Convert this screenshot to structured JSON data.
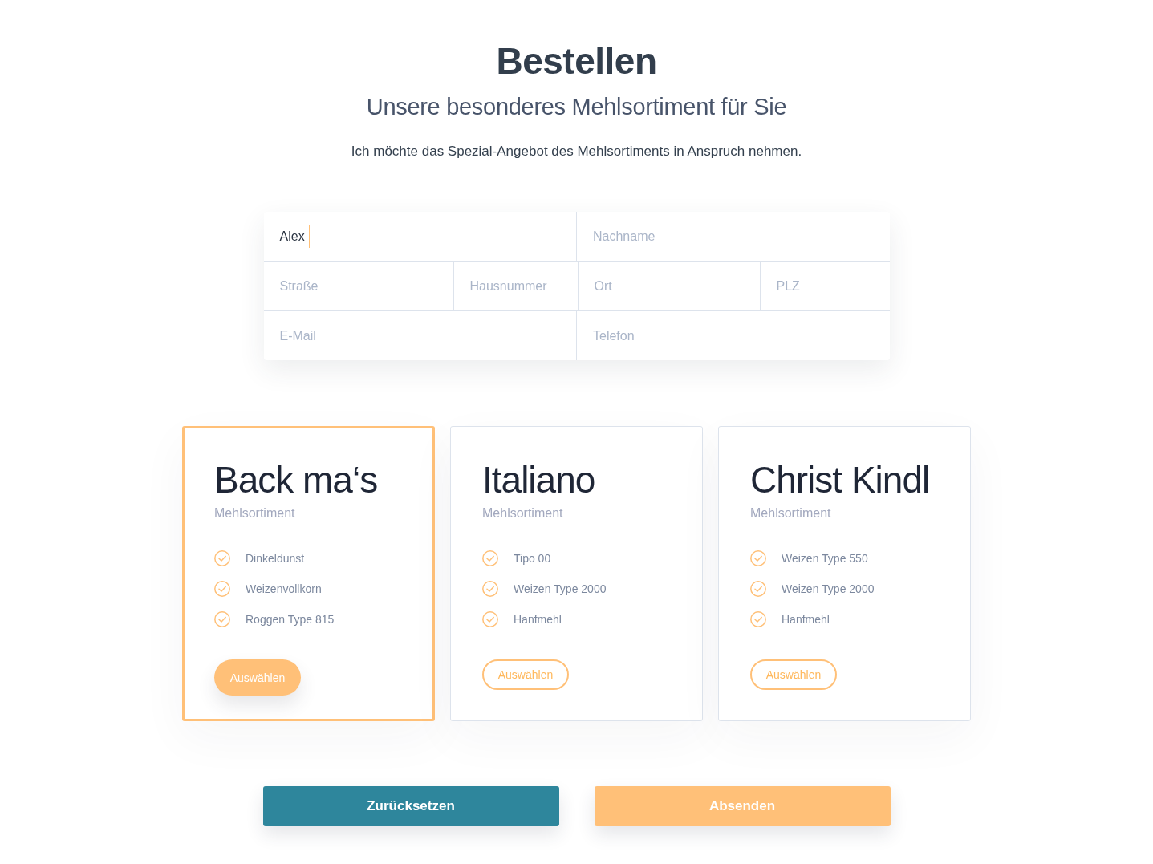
{
  "header": {
    "title": "Bestellen",
    "subtitle": "Unsere besonderes Mehlsortiment für Sie",
    "intro": "Ich möchte das Spezial-Angebot des Mehlsortiments in Anspruch nehmen."
  },
  "form": {
    "rows": [
      [
        {
          "value": "Alex",
          "focused": true
        },
        {
          "placeholder": "Nachname",
          "focused": false
        }
      ],
      [
        {
          "placeholder": "Straße",
          "focused": false
        },
        {
          "placeholder": "Hausnummer",
          "focused": false
        },
        {
          "placeholder": "Ort",
          "focused": false
        },
        {
          "placeholder": "PLZ",
          "focused": false
        }
      ],
      [
        {
          "placeholder": "E-Mail",
          "focused": false
        },
        {
          "placeholder": "Telefon",
          "focused": false
        }
      ]
    ]
  },
  "offers": [
    {
      "name": "Back ma‘s",
      "subtitle": "Mehlsortiment",
      "items": [
        "Dinkeldunst",
        "Weizenvollkorn",
        "Roggen Type 815"
      ],
      "button": "Auswählen",
      "selected": true
    },
    {
      "name": "Italiano",
      "subtitle": "Mehlsortiment",
      "items": [
        "Tipo 00",
        "Weizen Type 2000",
        "Hanfmehl"
      ],
      "button": "Auswählen",
      "selected": false
    },
    {
      "name": "Christ Kindl",
      "subtitle": "Mehlsortiment",
      "items": [
        "Weizen Type 550",
        "Weizen Type 2000",
        "Hanfmehl"
      ],
      "button": "Auswählen",
      "selected": false
    }
  ],
  "actions": [
    {
      "label": "Zurücksetzen",
      "kind": "secondary"
    },
    {
      "label": "Absenden",
      "kind": "primary"
    }
  ]
}
